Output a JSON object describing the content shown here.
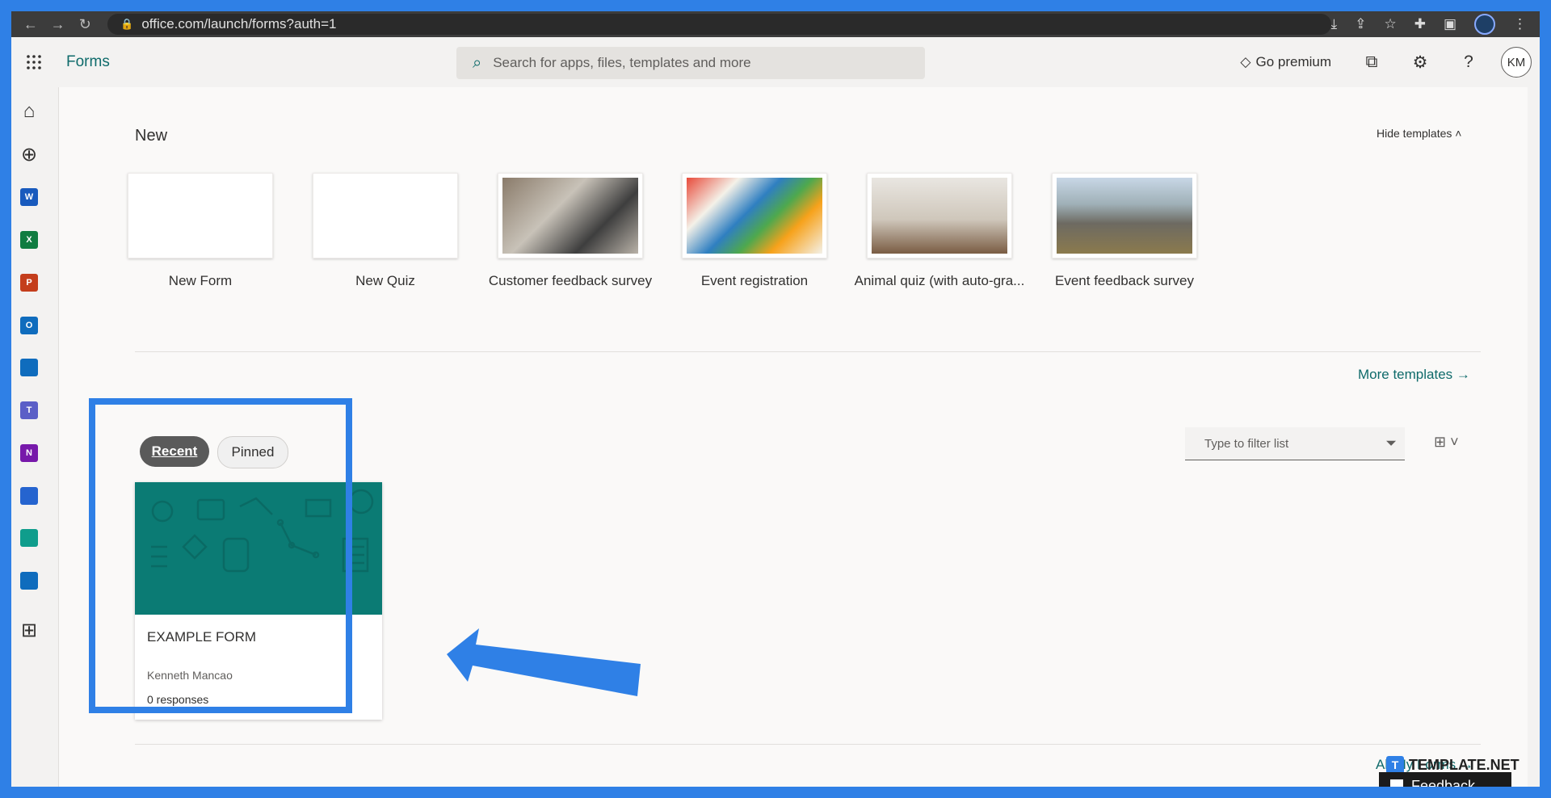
{
  "browser": {
    "url": "office.com/launch/forms?auth=1"
  },
  "header": {
    "app_name": "Forms",
    "search_placeholder": "Search for apps, files, templates and more",
    "premium_label": "Go premium",
    "avatar_initials": "KM"
  },
  "rail": {
    "apps": [
      {
        "name": "Word",
        "letter": "W",
        "color": "#185abd"
      },
      {
        "name": "Excel",
        "letter": "X",
        "color": "#107c41"
      },
      {
        "name": "PowerPoint",
        "letter": "P",
        "color": "#c43e1c"
      },
      {
        "name": "Outlook",
        "letter": "O",
        "color": "#0f6cbd"
      },
      {
        "name": "OneDrive",
        "letter": "",
        "color": "#0f6cbd"
      },
      {
        "name": "Teams",
        "letter": "T",
        "color": "#5b5fc7"
      },
      {
        "name": "OneNote",
        "letter": "N",
        "color": "#7719aa"
      },
      {
        "name": "To Do",
        "letter": "",
        "color": "#2564cf"
      },
      {
        "name": "Family Safety",
        "letter": "",
        "color": "#0f9d8c"
      },
      {
        "name": "Calendar",
        "letter": "",
        "color": "#0f6cbd"
      }
    ]
  },
  "new_section": {
    "title": "New",
    "hide_templates_label": "Hide templates ˄",
    "more_templates_label": "More templates →",
    "templates": [
      {
        "label": "New Form",
        "kind": "blank"
      },
      {
        "label": "New Quiz",
        "kind": "blank"
      },
      {
        "label": "Customer feedback survey",
        "kind": "photo-office"
      },
      {
        "label": "Event registration",
        "kind": "photo-calendar"
      },
      {
        "label": "Animal quiz (with auto-gra...",
        "kind": "photo-chess"
      },
      {
        "label": "Event feedback survey",
        "kind": "photo-mountain"
      }
    ]
  },
  "list_section": {
    "tab_recent": "Recent",
    "tab_pinned": "Pinned",
    "filter_placeholder": "Type to filter list",
    "all_forms_label": "All My Forms →"
  },
  "form_card": {
    "title": "EXAMPLE FORM",
    "owner": "Kenneth Mancao",
    "responses": "0 responses",
    "cover_color": "#0b7b74"
  },
  "watermark": {
    "text": "TEMPLATE.NET"
  },
  "feedback": {
    "label": "Feedback"
  },
  "colors": {
    "accent_teal": "#0f6b6b",
    "highlight_blue": "#2f80e6"
  }
}
